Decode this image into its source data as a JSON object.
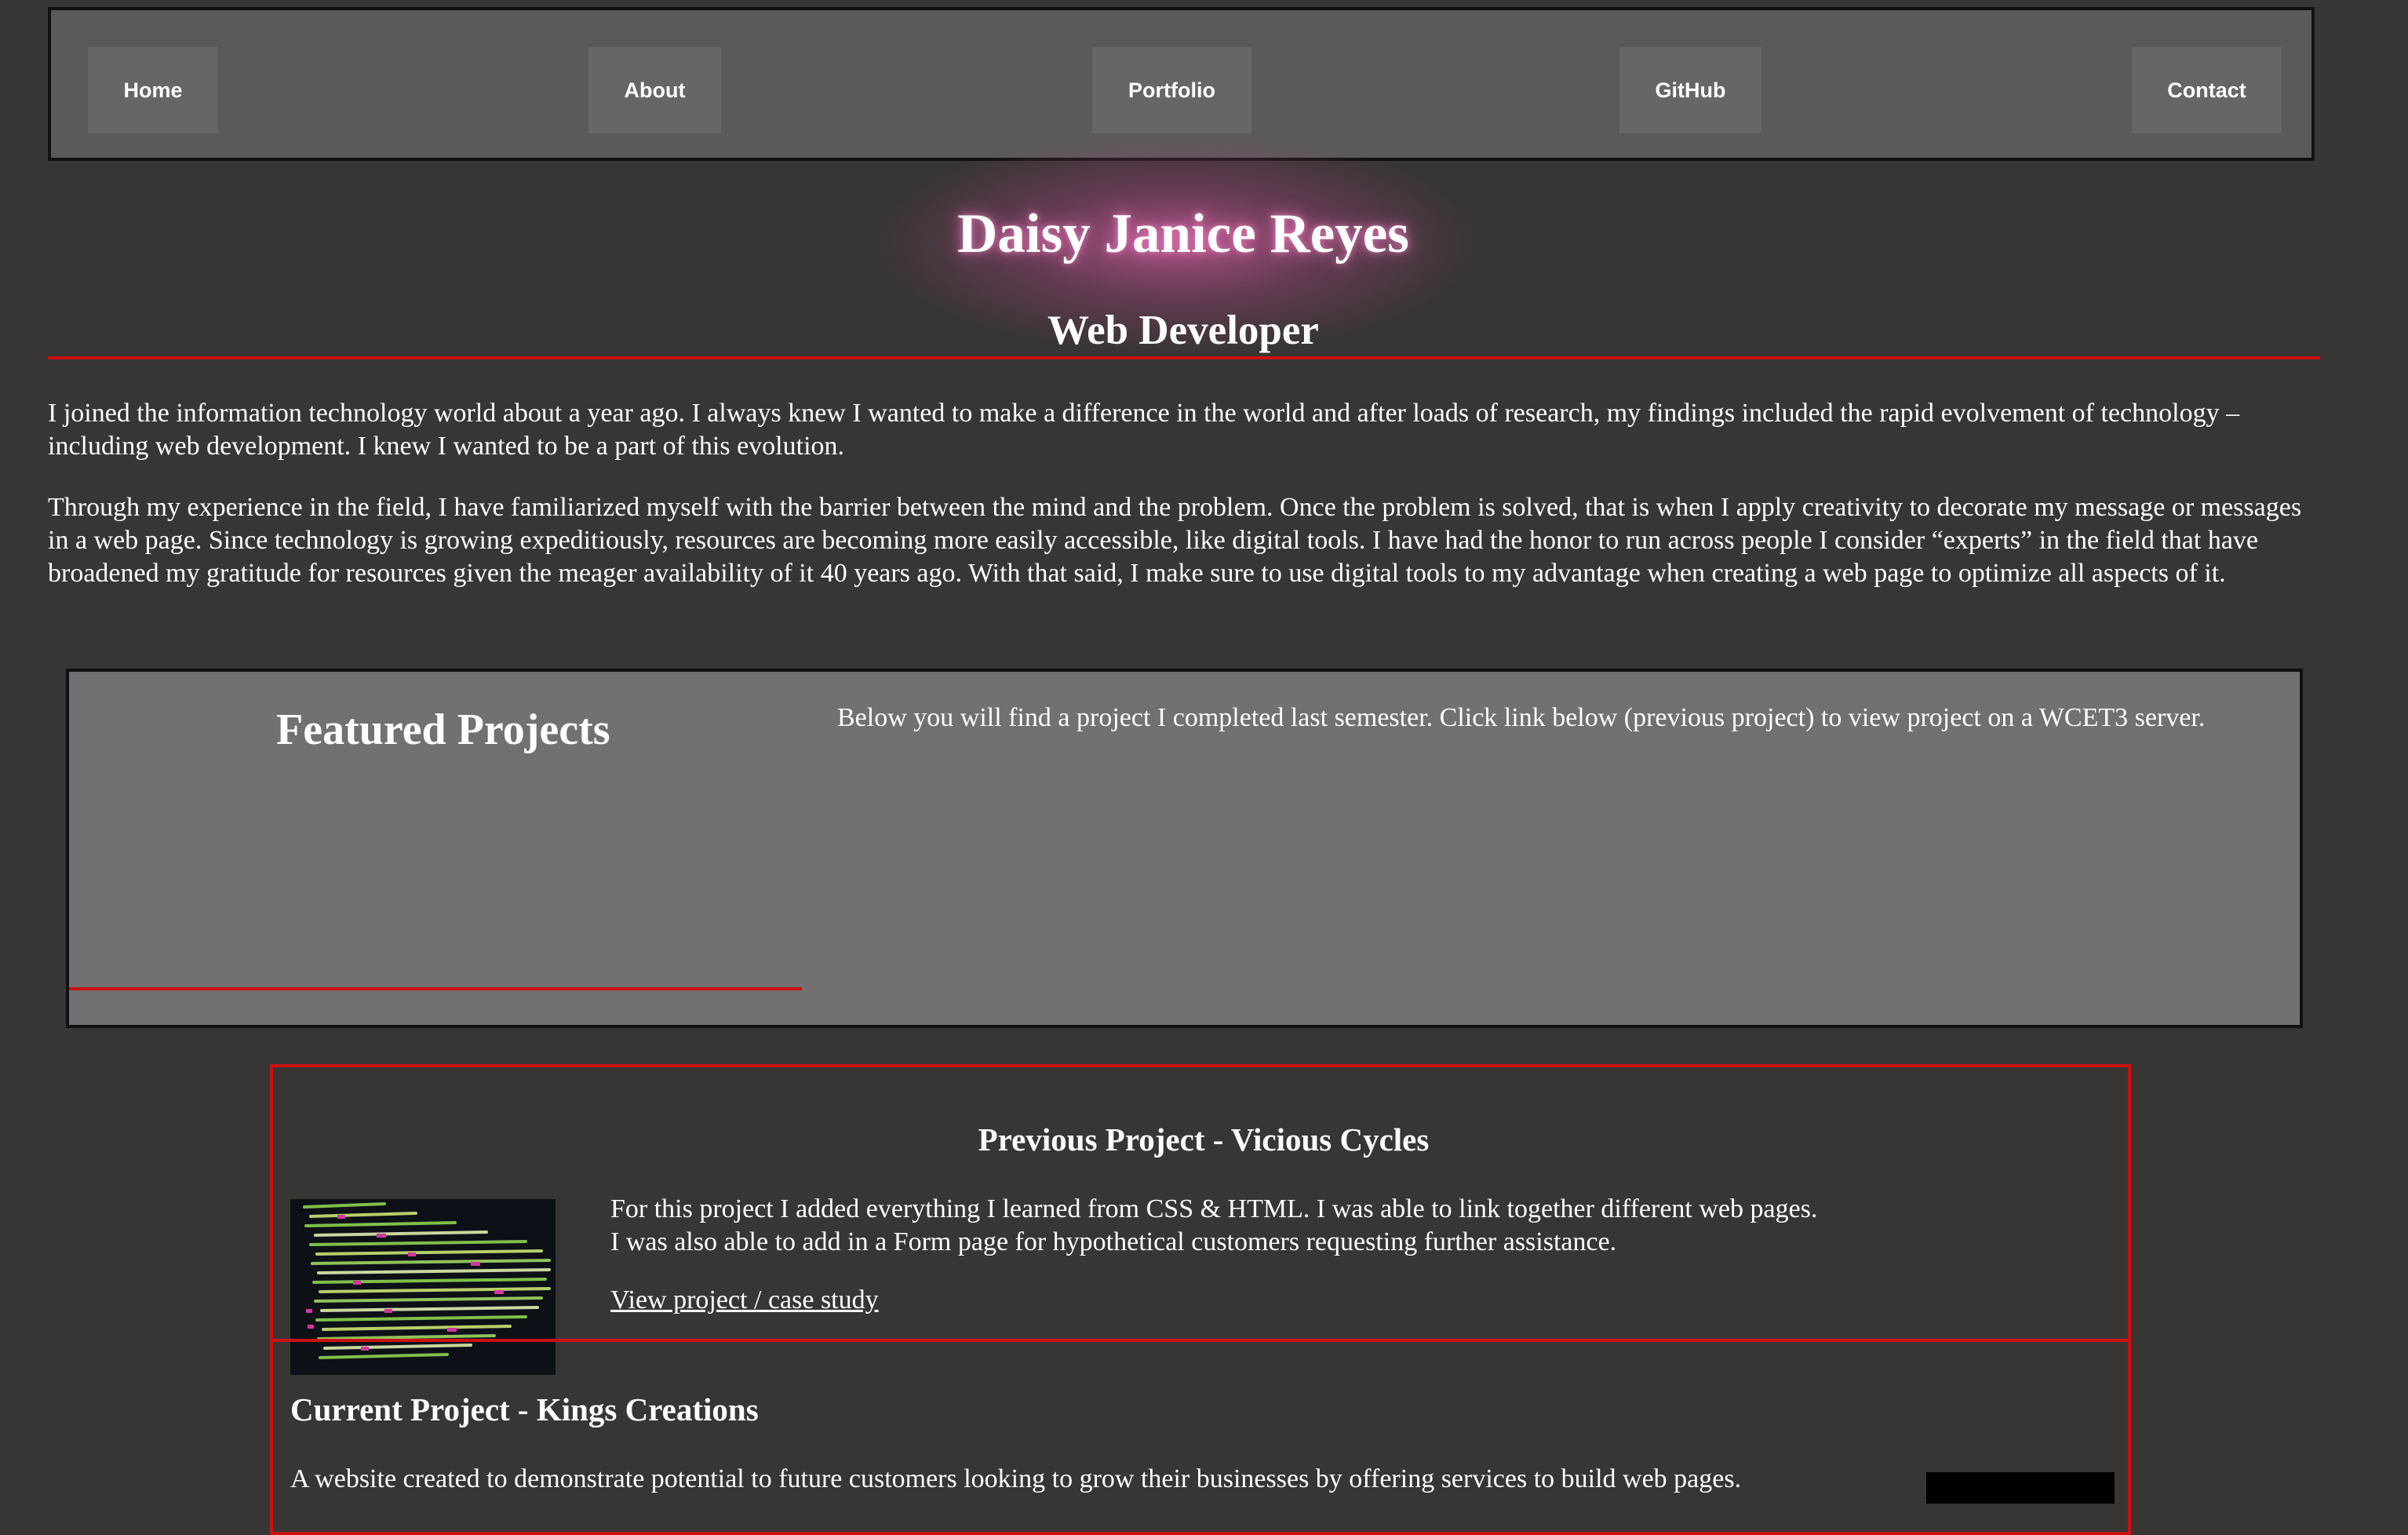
{
  "nav": {
    "items": [
      {
        "label": "Home"
      },
      {
        "label": "About"
      },
      {
        "label": "Portfolio"
      },
      {
        "label": "GitHub"
      },
      {
        "label": "Contact"
      }
    ]
  },
  "hero": {
    "name": "Daisy Janice Reyes",
    "role": "Web Developer"
  },
  "about": {
    "paragraphs": [
      "I joined the information technology world about a year ago. I always knew I wanted to make a difference in the world and after loads of research, my findings included the rapid evolvement of technology – including web development. I knew I wanted to be a part of this evolution.",
      "Through my experience in the field, I have familiarized myself with the barrier between the mind and the problem. Once the problem is solved, that is when I apply creativity to decorate my message or messages in a web page. Since technology is growing expeditiously, resources are becoming more easily accessible, like digital tools. I have had the honor to run across people I consider “experts” in the field that have broadened my gratitude for resources given the meager availability of it 40 years ago. With that said, I make sure to use digital tools to my advantage when creating a web page to optimize all aspects of it."
    ]
  },
  "featured": {
    "title": "Featured Projects",
    "text": "Below you will find a project I completed last semester. Click link below (previous project) to view project on a WCET3 server."
  },
  "previous_project": {
    "title": "Previous Project - Vicious Cycles",
    "line1": "For this project I added everything I learned from CSS & HTML. I was able to link together different web pages.",
    "line2": "I was also able to add in a Form page for hypothetical customers requesting further assistance.",
    "link": "View project / case study"
  },
  "current_project": {
    "title": "Current Project - Kings Creations",
    "text": "A website created to demonstrate potential to future customers looking to grow their businesses by offering services to build web pages."
  },
  "colors": {
    "background": "#383535",
    "nav": "#5a5a5a",
    "accent_red": "#cc1111",
    "featured_bg": "#727072"
  }
}
